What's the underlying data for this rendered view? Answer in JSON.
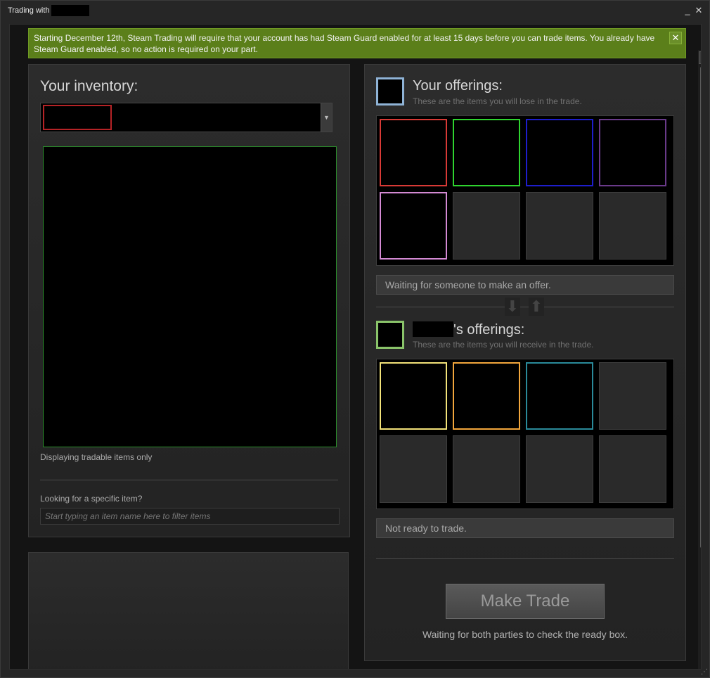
{
  "window": {
    "title": "Trading with",
    "minimize_label": "_",
    "close_label": "✕"
  },
  "notice": {
    "text": "Starting December 12th, Steam Trading will require that your account has had Steam Guard enabled for at least 15 days before you can trade items. You already have Steam Guard enabled, so no action is required on your part.",
    "close_label": "✕"
  },
  "inventory": {
    "title": "Your inventory:",
    "displaying_label": "Displaying tradable items only",
    "looking_label": "Looking for a specific item?",
    "search_placeholder": "Start typing an item name here to filter items"
  },
  "your_offerings": {
    "title": "Your offerings:",
    "subtitle": "These are the items you will lose in the trade.",
    "slots": [
      "#d83a36",
      "#2fd42f",
      "#1e1ecc",
      "#6a3a8a",
      "#d48ad4",
      "",
      "",
      ""
    ],
    "status": "Waiting for someone to make an offer."
  },
  "their_offerings": {
    "title": "'s offerings:",
    "subtitle": "These are the items you will receive in the trade.",
    "slots": [
      "#f2e279",
      "#f2a63c",
      "#2a8a9a",
      "",
      "",
      "",
      "",
      ""
    ],
    "status": "Not ready to trade."
  },
  "trade": {
    "make_trade_label": "Make Trade",
    "waiting_label": "Waiting for both parties to check the ready box."
  },
  "icons": {
    "swap_down": "⬇",
    "swap_up": "⬆",
    "scroll_up": "▲",
    "scroll_down": "▼",
    "select_arrow": "▼",
    "grip": "⋮⋮⋮",
    "resize": "⋰"
  }
}
